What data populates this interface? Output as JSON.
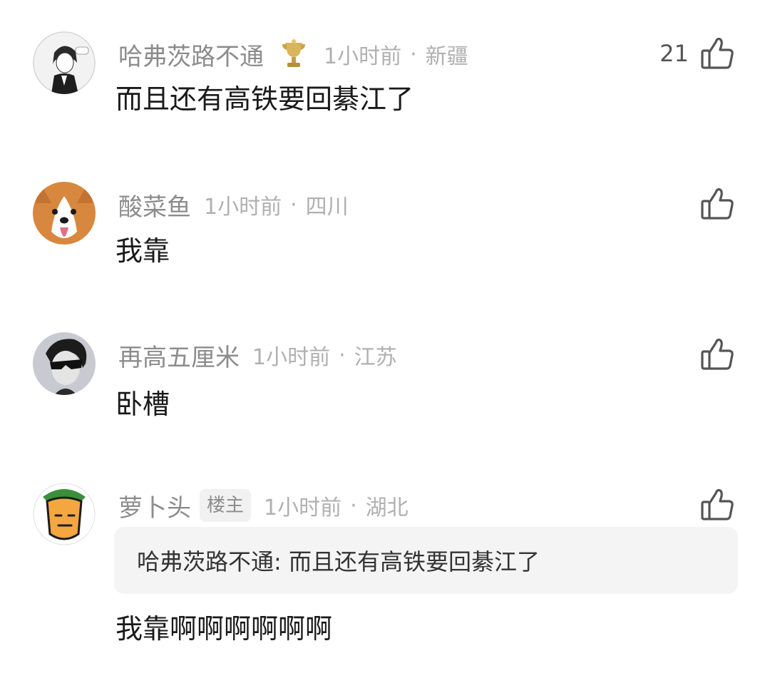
{
  "comments": [
    {
      "username": "哈弗茨路不通",
      "time": "1小时前",
      "separator": "·",
      "location": "新疆",
      "likes": "21",
      "content": "而且还有高铁要回綦江了",
      "badge_icon": "trophy-icon"
    },
    {
      "username": "酸菜鱼",
      "time": "1小时前",
      "separator": "·",
      "location": "四川",
      "likes": "",
      "content": "我靠"
    },
    {
      "username": "再高五厘米",
      "time": "1小时前",
      "separator": "·",
      "location": "江苏",
      "likes": "",
      "content": "卧槽"
    },
    {
      "username": "萝卜头",
      "op_badge": "楼主",
      "time": "1小时前",
      "separator": "·",
      "location": "湖北",
      "likes": "",
      "quote": "哈弗茨路不通: 而且还有高铁要回綦江了",
      "content": "我靠啊啊啊啊啊啊"
    }
  ],
  "icons": {
    "like": "thumbs-up-icon",
    "like_color": "#555555"
  },
  "colors": {
    "username": "#8c8c8c",
    "meta": "#b0b0b0",
    "text": "#1a1a1a",
    "quote_bg": "#f4f4f4"
  }
}
